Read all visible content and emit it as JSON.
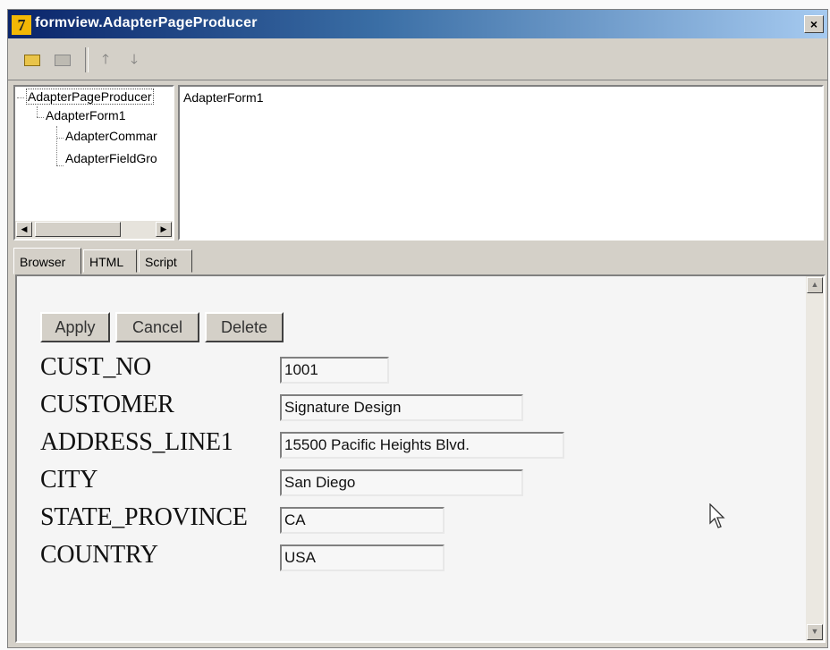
{
  "window": {
    "title": "formview.AdapterPageProducer",
    "close_label": "×"
  },
  "toolbar": {
    "up_glyph": "🡑",
    "down_glyph": "🡓"
  },
  "tree": {
    "items": [
      {
        "label": "AdapterPageProducer"
      },
      {
        "label": "AdapterForm1"
      },
      {
        "label": "AdapterCommar"
      },
      {
        "label": "AdapterFieldGro"
      }
    ],
    "scroll_left": "◀",
    "scroll_right": "▶"
  },
  "preview": {
    "content": "AdapterForm1"
  },
  "tabs": [
    "Browser",
    "HTML",
    "Script"
  ],
  "form": {
    "buttons": {
      "apply": "Apply",
      "cancel": "Cancel",
      "delete": "Delete"
    },
    "fields": [
      {
        "label": "CUST_NO",
        "value": "1001"
      },
      {
        "label": "CUSTOMER",
        "value": "Signature Design"
      },
      {
        "label": "ADDRESS_LINE1",
        "value": "15500 Pacific Heights Blvd."
      },
      {
        "label": "CITY",
        "value": "San Diego"
      },
      {
        "label": "STATE_PROVINCE",
        "value": "CA"
      },
      {
        "label": "COUNTRY",
        "value": "USA"
      }
    ]
  },
  "scroll": {
    "up": "▲",
    "down": "▼"
  },
  "colors": {
    "titlebar_start": "#0a246a",
    "titlebar_end": "#a6caf0",
    "chrome": "#d4d0c8"
  }
}
